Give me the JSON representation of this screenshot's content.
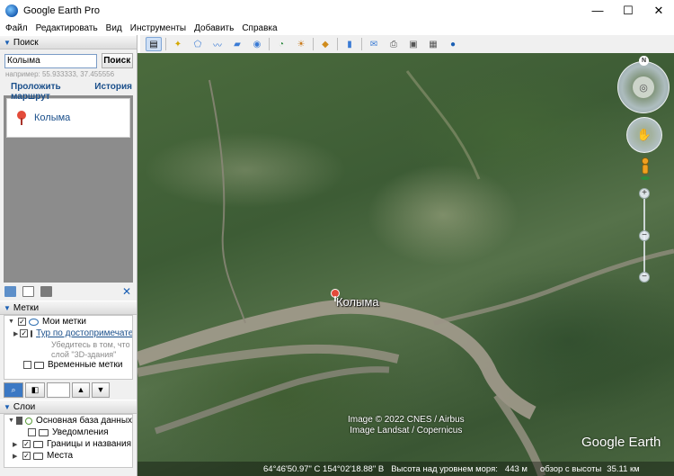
{
  "window": {
    "title": "Google Earth Pro",
    "controls": [
      "—",
      "☐",
      "✕"
    ]
  },
  "menu": [
    "Файл",
    "Редактировать",
    "Вид",
    "Инструменты",
    "Добавить",
    "Справка"
  ],
  "search": {
    "header": "Поиск",
    "value": "Колыма",
    "button": "Поиск",
    "hint": "например: 55.933333, 37.455556",
    "route_link": "Проложить маршрут",
    "history_link": "История",
    "result": "Колыма"
  },
  "places": {
    "header": "Метки",
    "items": [
      {
        "label": "Мои метки",
        "checked": true
      },
      {
        "label": "Тур по достопримечате",
        "checked": true
      },
      {
        "label": "Убедитесь в том, что",
        "note": true
      },
      {
        "label": "слой \"3D-здания\"",
        "note": true
      },
      {
        "label": "Временные метки",
        "checked": false
      }
    ]
  },
  "layers": {
    "header": "Слои",
    "items": [
      {
        "label": "Основная база данных"
      },
      {
        "label": "Уведомления"
      },
      {
        "label": "Границы и названия"
      },
      {
        "label": "Места"
      }
    ]
  },
  "map": {
    "place_label": "Колыма",
    "credit_line1": "Image © 2022 CNES / Airbus",
    "credit_line2": "Image Landsat / Copernicus",
    "logo": "Google Earth",
    "compass_n": "N"
  },
  "status": {
    "coords": "64°46'50.97\" С   154°02'18.88\" В",
    "elevation_label": "Высота над уровнем моря:",
    "elevation_value": "443 м",
    "eye_alt_label": "обзор с высоты",
    "eye_alt_value": "35.11 км"
  }
}
